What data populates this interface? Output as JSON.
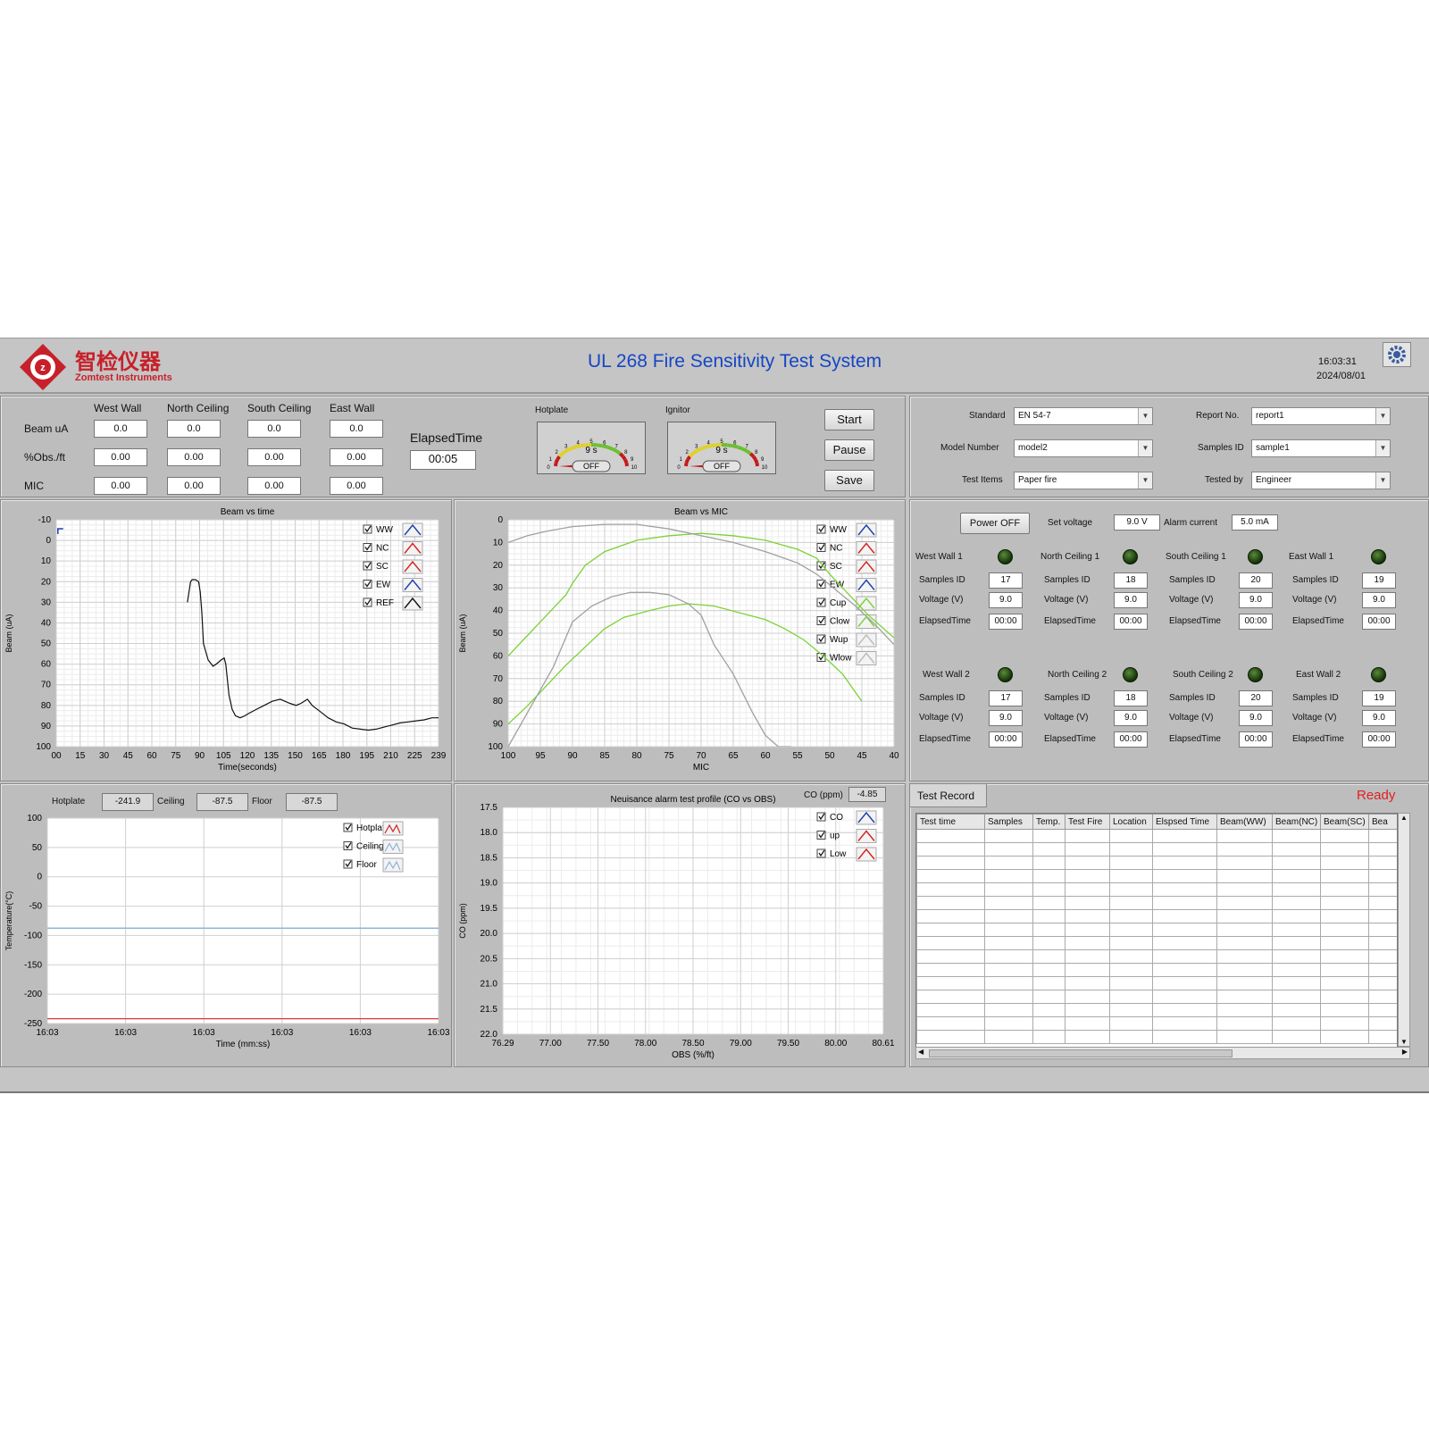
{
  "header": {
    "company_cn": "智检仪器",
    "company_en": "Zomtest Instruments",
    "title": "UL 268 Fire Sensitivity Test System",
    "time": "16:03:31",
    "date": "2024/08/01"
  },
  "readings": {
    "columns": [
      "West Wall",
      "North Ceiling",
      "South Ceiling",
      "East Wall"
    ],
    "rows": [
      {
        "label": "Beam uA",
        "values": [
          "0.0",
          "0.0",
          "0.0",
          "0.0"
        ]
      },
      {
        "label": "%Obs./ft",
        "values": [
          "0.00",
          "0.00",
          "0.00",
          "0.00"
        ]
      },
      {
        "label": "MIC",
        "values": [
          "0.00",
          "0.00",
          "0.00",
          "0.00"
        ]
      }
    ],
    "elapsed_label": "ElapsedTime",
    "elapsed_value": "00:05"
  },
  "gauges": [
    {
      "label": "Hotplate",
      "value_text": "9 s",
      "switch": "OFF",
      "ticks": [
        "0",
        "1",
        "2",
        "3",
        "4",
        "5",
        "6",
        "7",
        "8",
        "9",
        "10"
      ],
      "level": 0.0
    },
    {
      "label": "Ignitor",
      "value_text": "9 s",
      "switch": "OFF",
      "ticks": [
        "0",
        "1",
        "2",
        "3",
        "4",
        "5",
        "6",
        "7",
        "8",
        "9",
        "10"
      ],
      "level": 0.0
    }
  ],
  "controls": {
    "start": "Start",
    "pause": "Pause",
    "save": "Save"
  },
  "settings": {
    "standard_label": "Standard",
    "standard": "EN 54-7",
    "model_label": "Model Number",
    "model": "model2",
    "items_label": "Test Items",
    "items": "Paper fire",
    "report_label": "Report No.",
    "report": "report1",
    "samples_label": "Samples ID",
    "samples": "sample1",
    "tested_label": "Tested by",
    "tested": "Engineer"
  },
  "power": {
    "button": "Power OFF",
    "set_voltage_label": "Set voltage",
    "set_voltage": "9.0 V",
    "alarm_current_label": "Alarm current",
    "alarm_current": "5.0 mA"
  },
  "detectors": [
    {
      "name": "West Wall 1",
      "samples": "17",
      "voltage": "9.0",
      "elapsed": "00:00"
    },
    {
      "name": "North Ceiling 1",
      "samples": "18",
      "voltage": "9.0",
      "elapsed": "00:00"
    },
    {
      "name": "South Ceiling 1",
      "samples": "20",
      "voltage": "9.0",
      "elapsed": "00:00"
    },
    {
      "name": "East Wall 1",
      "samples": "19",
      "voltage": "9.0",
      "elapsed": "00:00"
    },
    {
      "name": "West Wall 2",
      "samples": "17",
      "voltage": "9.0",
      "elapsed": "00:00"
    },
    {
      "name": "North Ceiling 2",
      "samples": "18",
      "voltage": "9.0",
      "elapsed": "00:00"
    },
    {
      "name": "South Ceiling 2",
      "samples": "20",
      "voltage": "9.0",
      "elapsed": "00:00"
    },
    {
      "name": "East Wall 2",
      "samples": "19",
      "voltage": "9.0",
      "elapsed": "00:00"
    }
  ],
  "detector_labels": {
    "samples": "Samples ID",
    "voltage": "Voltage (V)",
    "elapsed": "ElapsedTime"
  },
  "temps": {
    "hotplate_label": "Hotplate",
    "hotplate": "-241.9",
    "ceiling_label": "Ceiling",
    "ceiling": "-87.5",
    "floor_label": "Floor",
    "floor": "-87.5"
  },
  "co": {
    "label": "CO (ppm)",
    "value": "-4.85"
  },
  "record": {
    "tab": "Test Record",
    "status": "Ready",
    "columns": [
      "Test time",
      "Samples",
      "Temp.",
      "Test Fire",
      "Location",
      "Elspsed Time",
      "Beam(WW)",
      "Beam(NC)",
      "Beam(SC)",
      "Bea"
    ]
  },
  "colors": {
    "blue": "#1a3fae",
    "red": "#d42020",
    "green": "#7cd235",
    "gray": "#a0a0a0",
    "title": "#1546c4",
    "ready": "#e02020"
  },
  "chart_data": [
    {
      "type": "line",
      "title": "Beam vs time",
      "xlabel": "Time(seconds)",
      "ylabel": "Beam (uA)",
      "xticks": [
        "00",
        "15",
        "30",
        "45",
        "60",
        "75",
        "90",
        "105",
        "120",
        "135",
        "150",
        "165",
        "180",
        "195",
        "210",
        "225",
        "239"
      ],
      "xlim": [
        0,
        239
      ],
      "ylim": [
        -10,
        100
      ],
      "y_reversed": true,
      "yticks": [
        "-10",
        "0",
        "10",
        "20",
        "30",
        "40",
        "50",
        "60",
        "70",
        "80",
        "90",
        "100"
      ],
      "legend": [
        "WW",
        "NC",
        "SC",
        "EW",
        "REF"
      ],
      "series": [
        {
          "name": "REF",
          "color": "gray",
          "x": [
            82,
            83,
            84,
            85,
            87,
            89,
            90,
            91,
            92,
            95,
            98,
            100,
            103,
            105,
            106,
            108,
            110,
            112,
            115,
            118,
            120,
            125,
            130,
            135,
            140,
            143,
            146,
            150,
            153,
            155,
            157,
            160,
            165,
            170,
            175,
            180,
            185,
            190,
            195,
            200,
            205,
            210,
            215,
            220,
            225,
            230,
            235,
            239
          ],
          "y": [
            30,
            25,
            20,
            19,
            19,
            20,
            25,
            35,
            50,
            58,
            61,
            60,
            58,
            57,
            60,
            75,
            82,
            85,
            86,
            85,
            84,
            82,
            80,
            78,
            77,
            78,
            79,
            80,
            79,
            78,
            77,
            80,
            83,
            86,
            88,
            89,
            91,
            91.5,
            92,
            91.5,
            90.5,
            89.5,
            88.5,
            88,
            87.5,
            87,
            86,
            86
          ]
        }
      ]
    },
    {
      "type": "line",
      "title": "Beam vs MIC",
      "xlabel": "MIC",
      "ylabel": "Beam (uA)",
      "xlim": [
        100,
        40
      ],
      "ylim": [
        0,
        100
      ],
      "y_reversed": true,
      "xticks": [
        "100",
        "95",
        "90",
        "85",
        "80",
        "75",
        "70",
        "65",
        "60",
        "55",
        "50",
        "45",
        "40"
      ],
      "yticks": [
        "0",
        "10",
        "20",
        "30",
        "40",
        "50",
        "60",
        "70",
        "80",
        "90",
        "100"
      ],
      "legend": [
        "WW",
        "NC",
        "SC",
        "EW",
        "Cup",
        "Clow",
        "Wup",
        "Wlow"
      ],
      "series": [
        {
          "name": "Cup",
          "color": "green",
          "x": [
            100,
            97,
            94,
            91,
            90,
            88,
            85,
            80,
            75,
            70,
            65,
            60,
            55,
            52,
            50,
            47,
            44,
            40
          ],
          "y": [
            60,
            51,
            42,
            33,
            28,
            20,
            14,
            9,
            7,
            6,
            7,
            9,
            13,
            17,
            24,
            33,
            42,
            52
          ]
        },
        {
          "name": "Wup",
          "color": "gray",
          "x": [
            100,
            97,
            94,
            90,
            85,
            80,
            75,
            70,
            65,
            60,
            55,
            52,
            49,
            46,
            43,
            40
          ],
          "y": [
            10,
            7,
            5,
            3,
            2,
            2,
            4,
            7,
            10,
            14,
            19,
            24,
            31,
            38,
            46,
            55
          ]
        },
        {
          "name": "Clow",
          "color": "green",
          "x": [
            100,
            97,
            94,
            91,
            88,
            85,
            82,
            78,
            75,
            72,
            68,
            64,
            60,
            57,
            54,
            51,
            48,
            45
          ],
          "y": [
            90,
            82,
            73,
            64,
            56,
            48,
            43,
            40,
            38,
            37,
            38,
            41,
            44,
            48,
            53,
            60,
            68,
            80
          ]
        },
        {
          "name": "Wlow",
          "color": "gray",
          "x": [
            100,
            98,
            96,
            93,
            90,
            87,
            84,
            81,
            78,
            75,
            72,
            70,
            68,
            65,
            62,
            60,
            58,
            56
          ],
          "y": [
            100,
            90,
            80,
            65,
            45,
            38,
            34,
            32,
            32,
            33,
            37,
            42,
            55,
            68,
            85,
            95,
            100,
            100
          ]
        }
      ]
    },
    {
      "type": "line",
      "xlabel": "Time (mm:ss)",
      "ylabel": "Temperature(°C)",
      "ylim": [
        -250,
        100
      ],
      "yticks": [
        "100",
        "50",
        "0",
        "-50",
        "-100",
        "-150",
        "-200",
        "-250"
      ],
      "xticks": [
        "16:03",
        "16:03",
        "16:03",
        "16:03",
        "16:03",
        "16:03"
      ],
      "legend": [
        "Hotplate",
        "Ceiling",
        "Floor"
      ],
      "series": [
        {
          "name": "Hotplate",
          "color": "red",
          "y": -241.9
        },
        {
          "name": "Ceiling",
          "color": "gray",
          "y": -87.5
        },
        {
          "name": "Floor",
          "color": "lightblue",
          "y": -87.5
        }
      ]
    },
    {
      "type": "line",
      "title": "Neuisance alarm test profile (CO vs OBS)",
      "xlabel": "OBS (%/ft)",
      "ylabel": "CO (ppm)",
      "xlim": [
        76.29,
        80.61
      ],
      "ylim": [
        17.5,
        22.0
      ],
      "y_reversed": true,
      "xticks": [
        "76.29",
        "77.00",
        "77.50",
        "78.00",
        "78.50",
        "79.00",
        "79.50",
        "80.00",
        "80.61"
      ],
      "yticks": [
        "17.5",
        "18.0",
        "18.5",
        "19.0",
        "19.5",
        "20.0",
        "20.5",
        "21.0",
        "21.5",
        "22.0"
      ],
      "legend": [
        "CO",
        "up",
        "Low"
      ],
      "series": []
    }
  ]
}
